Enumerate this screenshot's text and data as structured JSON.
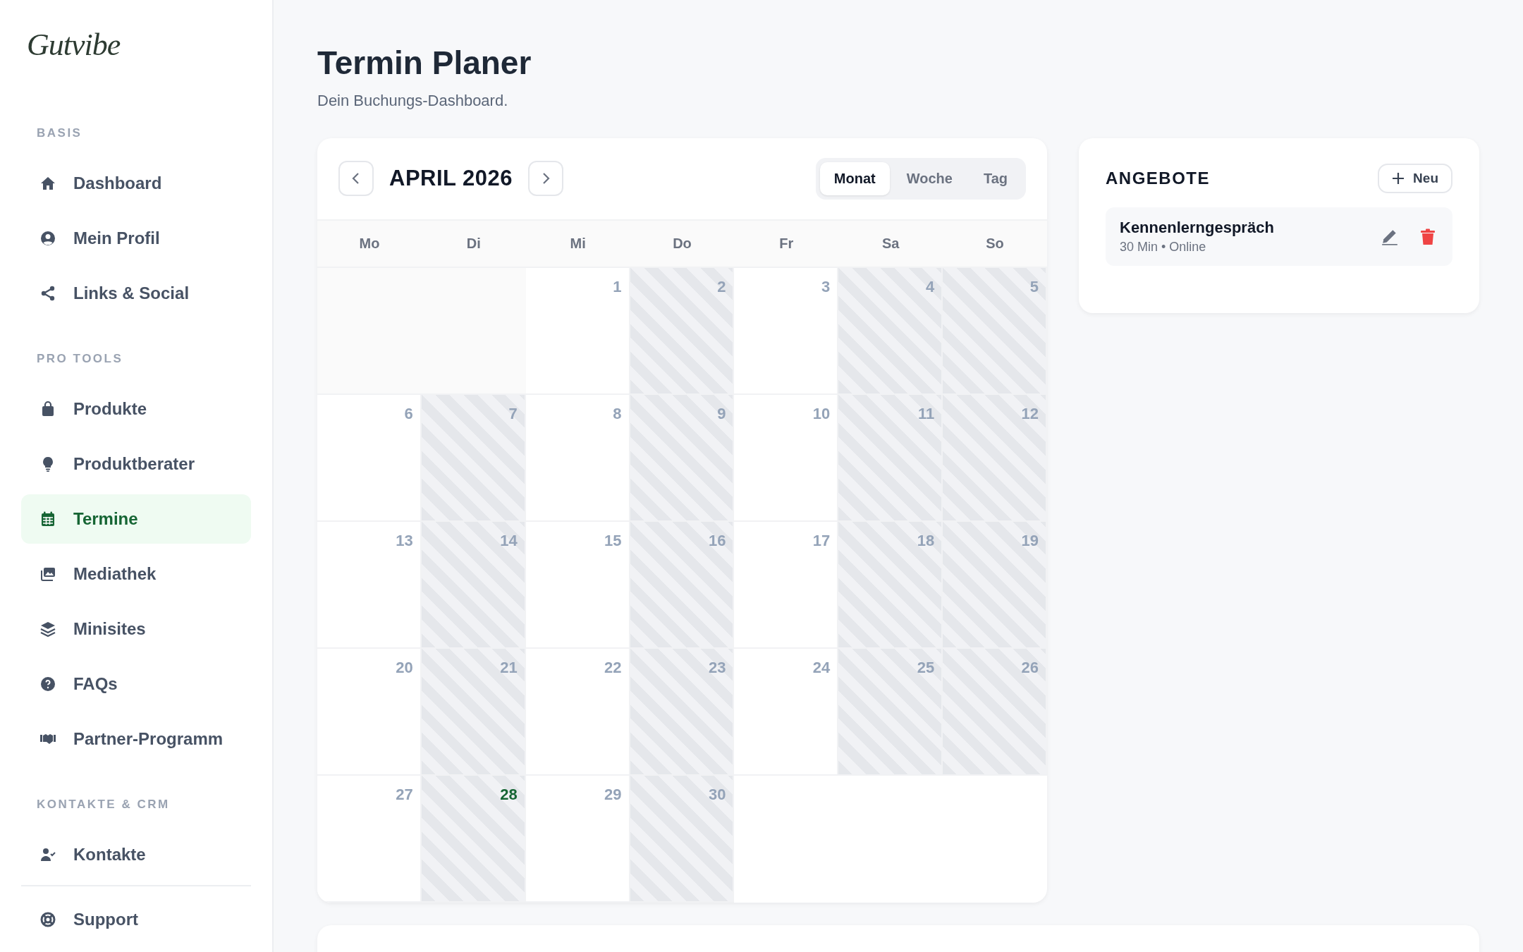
{
  "sidebar": {
    "logo": "Gutvibe",
    "sections": [
      {
        "label": "BASIS",
        "items": [
          {
            "label": "Dashboard",
            "selected": false
          },
          {
            "label": "Mein Profil",
            "selected": false
          },
          {
            "label": "Links & Social",
            "selected": false
          }
        ]
      },
      {
        "label": "PRO TOOLS",
        "items": [
          {
            "label": "Produkte",
            "selected": false
          },
          {
            "label": "Produktberater",
            "selected": false
          },
          {
            "label": "Termine",
            "selected": true
          },
          {
            "label": "Mediathek",
            "selected": false
          },
          {
            "label": "Minisites",
            "selected": false
          },
          {
            "label": "FAQs",
            "selected": false
          },
          {
            "label": "Partner-Programm",
            "selected": false
          }
        ]
      },
      {
        "label": "KONTAKTE & CRM",
        "items": [
          {
            "label": "Kontakte",
            "selected": false
          }
        ]
      }
    ],
    "footer_items": [
      {
        "label": "Support",
        "selected": false
      }
    ]
  },
  "header": {
    "title": "Termin Planer",
    "subtitle": "Dein Buchungs-Dashboard."
  },
  "calendar": {
    "month": "APRIL 2026",
    "views": [
      {
        "label": "Monat",
        "selected": true
      },
      {
        "label": "Woche",
        "selected": false
      },
      {
        "label": "Tag",
        "selected": false
      }
    ],
    "weekdays": [
      "Mo",
      "Di",
      "Mi",
      "Do",
      "Fr",
      "Sa",
      "So"
    ],
    "days": [
      {
        "kind": "empty"
      },
      {
        "kind": "empty"
      },
      {
        "kind": "day",
        "number": "1",
        "blocked": false,
        "today": false
      },
      {
        "kind": "day",
        "number": "2",
        "blocked": true,
        "today": false
      },
      {
        "kind": "day",
        "number": "3",
        "blocked": false,
        "today": false
      },
      {
        "kind": "day",
        "number": "4",
        "blocked": true,
        "today": false
      },
      {
        "kind": "day",
        "number": "5",
        "blocked": true,
        "today": false
      },
      {
        "kind": "day",
        "number": "6",
        "blocked": false,
        "today": false
      },
      {
        "kind": "day",
        "number": "7",
        "blocked": true,
        "today": false
      },
      {
        "kind": "day",
        "number": "8",
        "blocked": false,
        "today": false
      },
      {
        "kind": "day",
        "number": "9",
        "blocked": true,
        "today": false
      },
      {
        "kind": "day",
        "number": "10",
        "blocked": false,
        "today": false
      },
      {
        "kind": "day",
        "number": "11",
        "blocked": true,
        "today": false
      },
      {
        "kind": "day",
        "number": "12",
        "blocked": true,
        "today": false
      },
      {
        "kind": "day",
        "number": "13",
        "blocked": false,
        "today": false
      },
      {
        "kind": "day",
        "number": "14",
        "blocked": true,
        "today": false
      },
      {
        "kind": "day",
        "number": "15",
        "blocked": false,
        "today": false
      },
      {
        "kind": "day",
        "number": "16",
        "blocked": true,
        "today": false
      },
      {
        "kind": "day",
        "number": "17",
        "blocked": false,
        "today": false
      },
      {
        "kind": "day",
        "number": "18",
        "blocked": true,
        "today": false
      },
      {
        "kind": "day",
        "number": "19",
        "blocked": true,
        "today": false
      },
      {
        "kind": "day",
        "number": "20",
        "blocked": false,
        "today": false
      },
      {
        "kind": "day",
        "number": "21",
        "blocked": true,
        "today": false
      },
      {
        "kind": "day",
        "number": "22",
        "blocked": false,
        "today": false
      },
      {
        "kind": "day",
        "number": "23",
        "blocked": true,
        "today": false
      },
      {
        "kind": "day",
        "number": "24",
        "blocked": false,
        "today": false
      },
      {
        "kind": "day",
        "number": "25",
        "blocked": true,
        "today": false
      },
      {
        "kind": "day",
        "number": "26",
        "blocked": true,
        "today": false
      },
      {
        "kind": "day",
        "number": "27",
        "blocked": false,
        "today": false
      },
      {
        "kind": "day",
        "number": "28",
        "blocked": true,
        "today": true
      },
      {
        "kind": "day",
        "number": "29",
        "blocked": false,
        "today": false
      },
      {
        "kind": "day",
        "number": "30",
        "blocked": true,
        "today": false
      }
    ]
  },
  "offers": {
    "title": "ANGEBOTE",
    "new_button": "Neu",
    "items": [
      {
        "name": "Kennenlerngespräch",
        "meta": "30 Min • Online"
      }
    ]
  }
}
